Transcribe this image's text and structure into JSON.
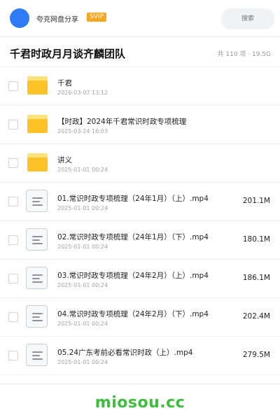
{
  "header": {
    "share_name": "夸克网盘分享",
    "badge": "SVIP",
    "search_placeholder": "搜索"
  },
  "folder": {
    "title": "千君时政月月谈齐麟团队",
    "summary": "共 110 项 · 19.5G"
  },
  "items": [
    {
      "type": "folder",
      "name": "千君",
      "date": "2026-03-07 13:12",
      "size": ""
    },
    {
      "type": "folder",
      "name": "【时政】2024年千君常识时政专项梳理",
      "date": "2025-03-24 16:03",
      "size": ""
    },
    {
      "type": "folder",
      "name": "讲义",
      "date": "2025-01-01 00:24",
      "size": ""
    },
    {
      "type": "file",
      "name": "01.常识时政专项梳理（24年1月）（上）.mp4",
      "date": "2025-01-01 00:24",
      "size": "201.1M"
    },
    {
      "type": "file",
      "name": "02.常识时政专项梳理（24年1月）（下）.mp4",
      "date": "2025-01-01 00:24",
      "size": "180.1M"
    },
    {
      "type": "file",
      "name": "03.常识时政专项梳理（24年2月）（上）.mp4",
      "date": "2025-01-01 00:24",
      "size": "186.1M"
    },
    {
      "type": "file",
      "name": "04.常识时政专项梳理（24年2月）（下）.mp4",
      "date": "2025-01-01 00:24",
      "size": "202.4M"
    },
    {
      "type": "file",
      "name": "05.24广东考前必看常识时政（上）.mp4",
      "date": "2025-01-01 00:24",
      "size": "279.5M"
    }
  ],
  "watermark": "miosou.cc",
  "colors": {
    "accent": "#2f7bf5",
    "svip": "#f5a623",
    "folder": "#fdc228",
    "watermark": "#3dbd3d"
  }
}
